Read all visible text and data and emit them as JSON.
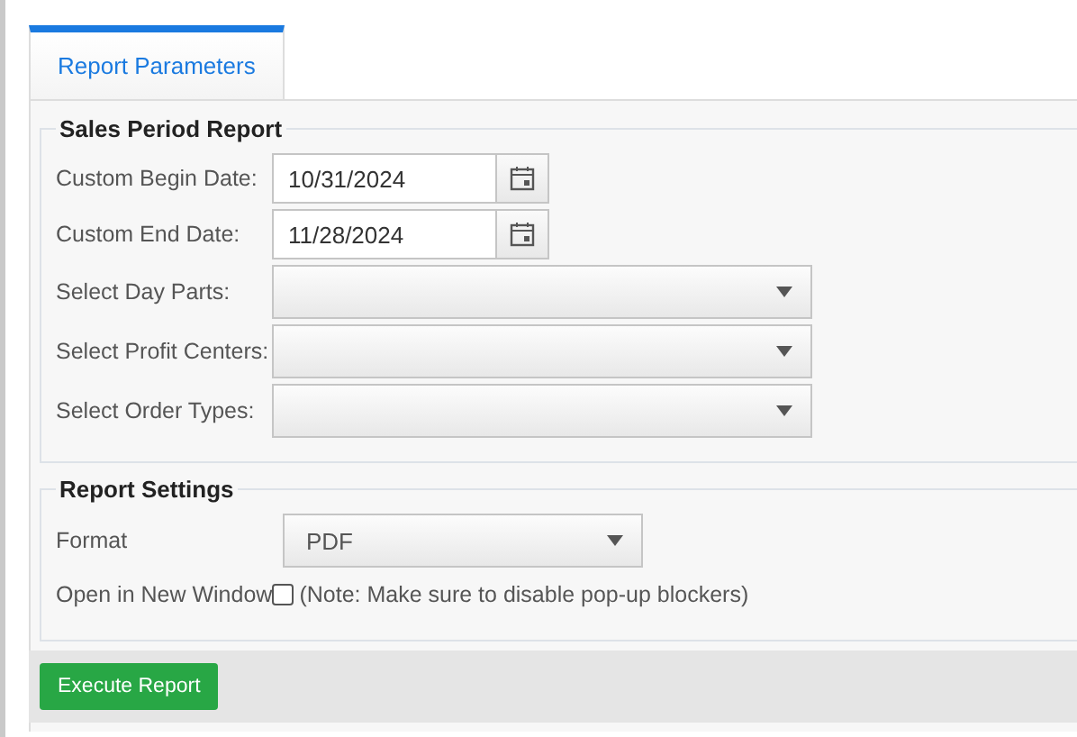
{
  "tabs": [
    {
      "label": "Report Parameters",
      "selected": true
    }
  ],
  "sections": [
    {
      "title": "Sales Period Report",
      "fields": [
        {
          "kind": "date",
          "label": "Custom Begin Date:",
          "value": "10/31/2024"
        },
        {
          "kind": "date",
          "label": "Custom End Date:",
          "value": "11/28/2024"
        },
        {
          "kind": "select",
          "label": "Select Day Parts:"
        },
        {
          "kind": "select",
          "label": "Select Profit Centers:"
        },
        {
          "kind": "select",
          "label": "Select Order Types:"
        }
      ]
    },
    {
      "title": "Report Settings",
      "fields": [
        {
          "kind": "select",
          "label": "Format",
          "value": "PDF"
        },
        {
          "kind": "checkbox",
          "label": "Open in New Window",
          "checked": false,
          "note": "(Note: Make sure to disable pop-up blockers)"
        }
      ]
    }
  ],
  "buttons": [
    {
      "label": "Execute Report"
    }
  ]
}
